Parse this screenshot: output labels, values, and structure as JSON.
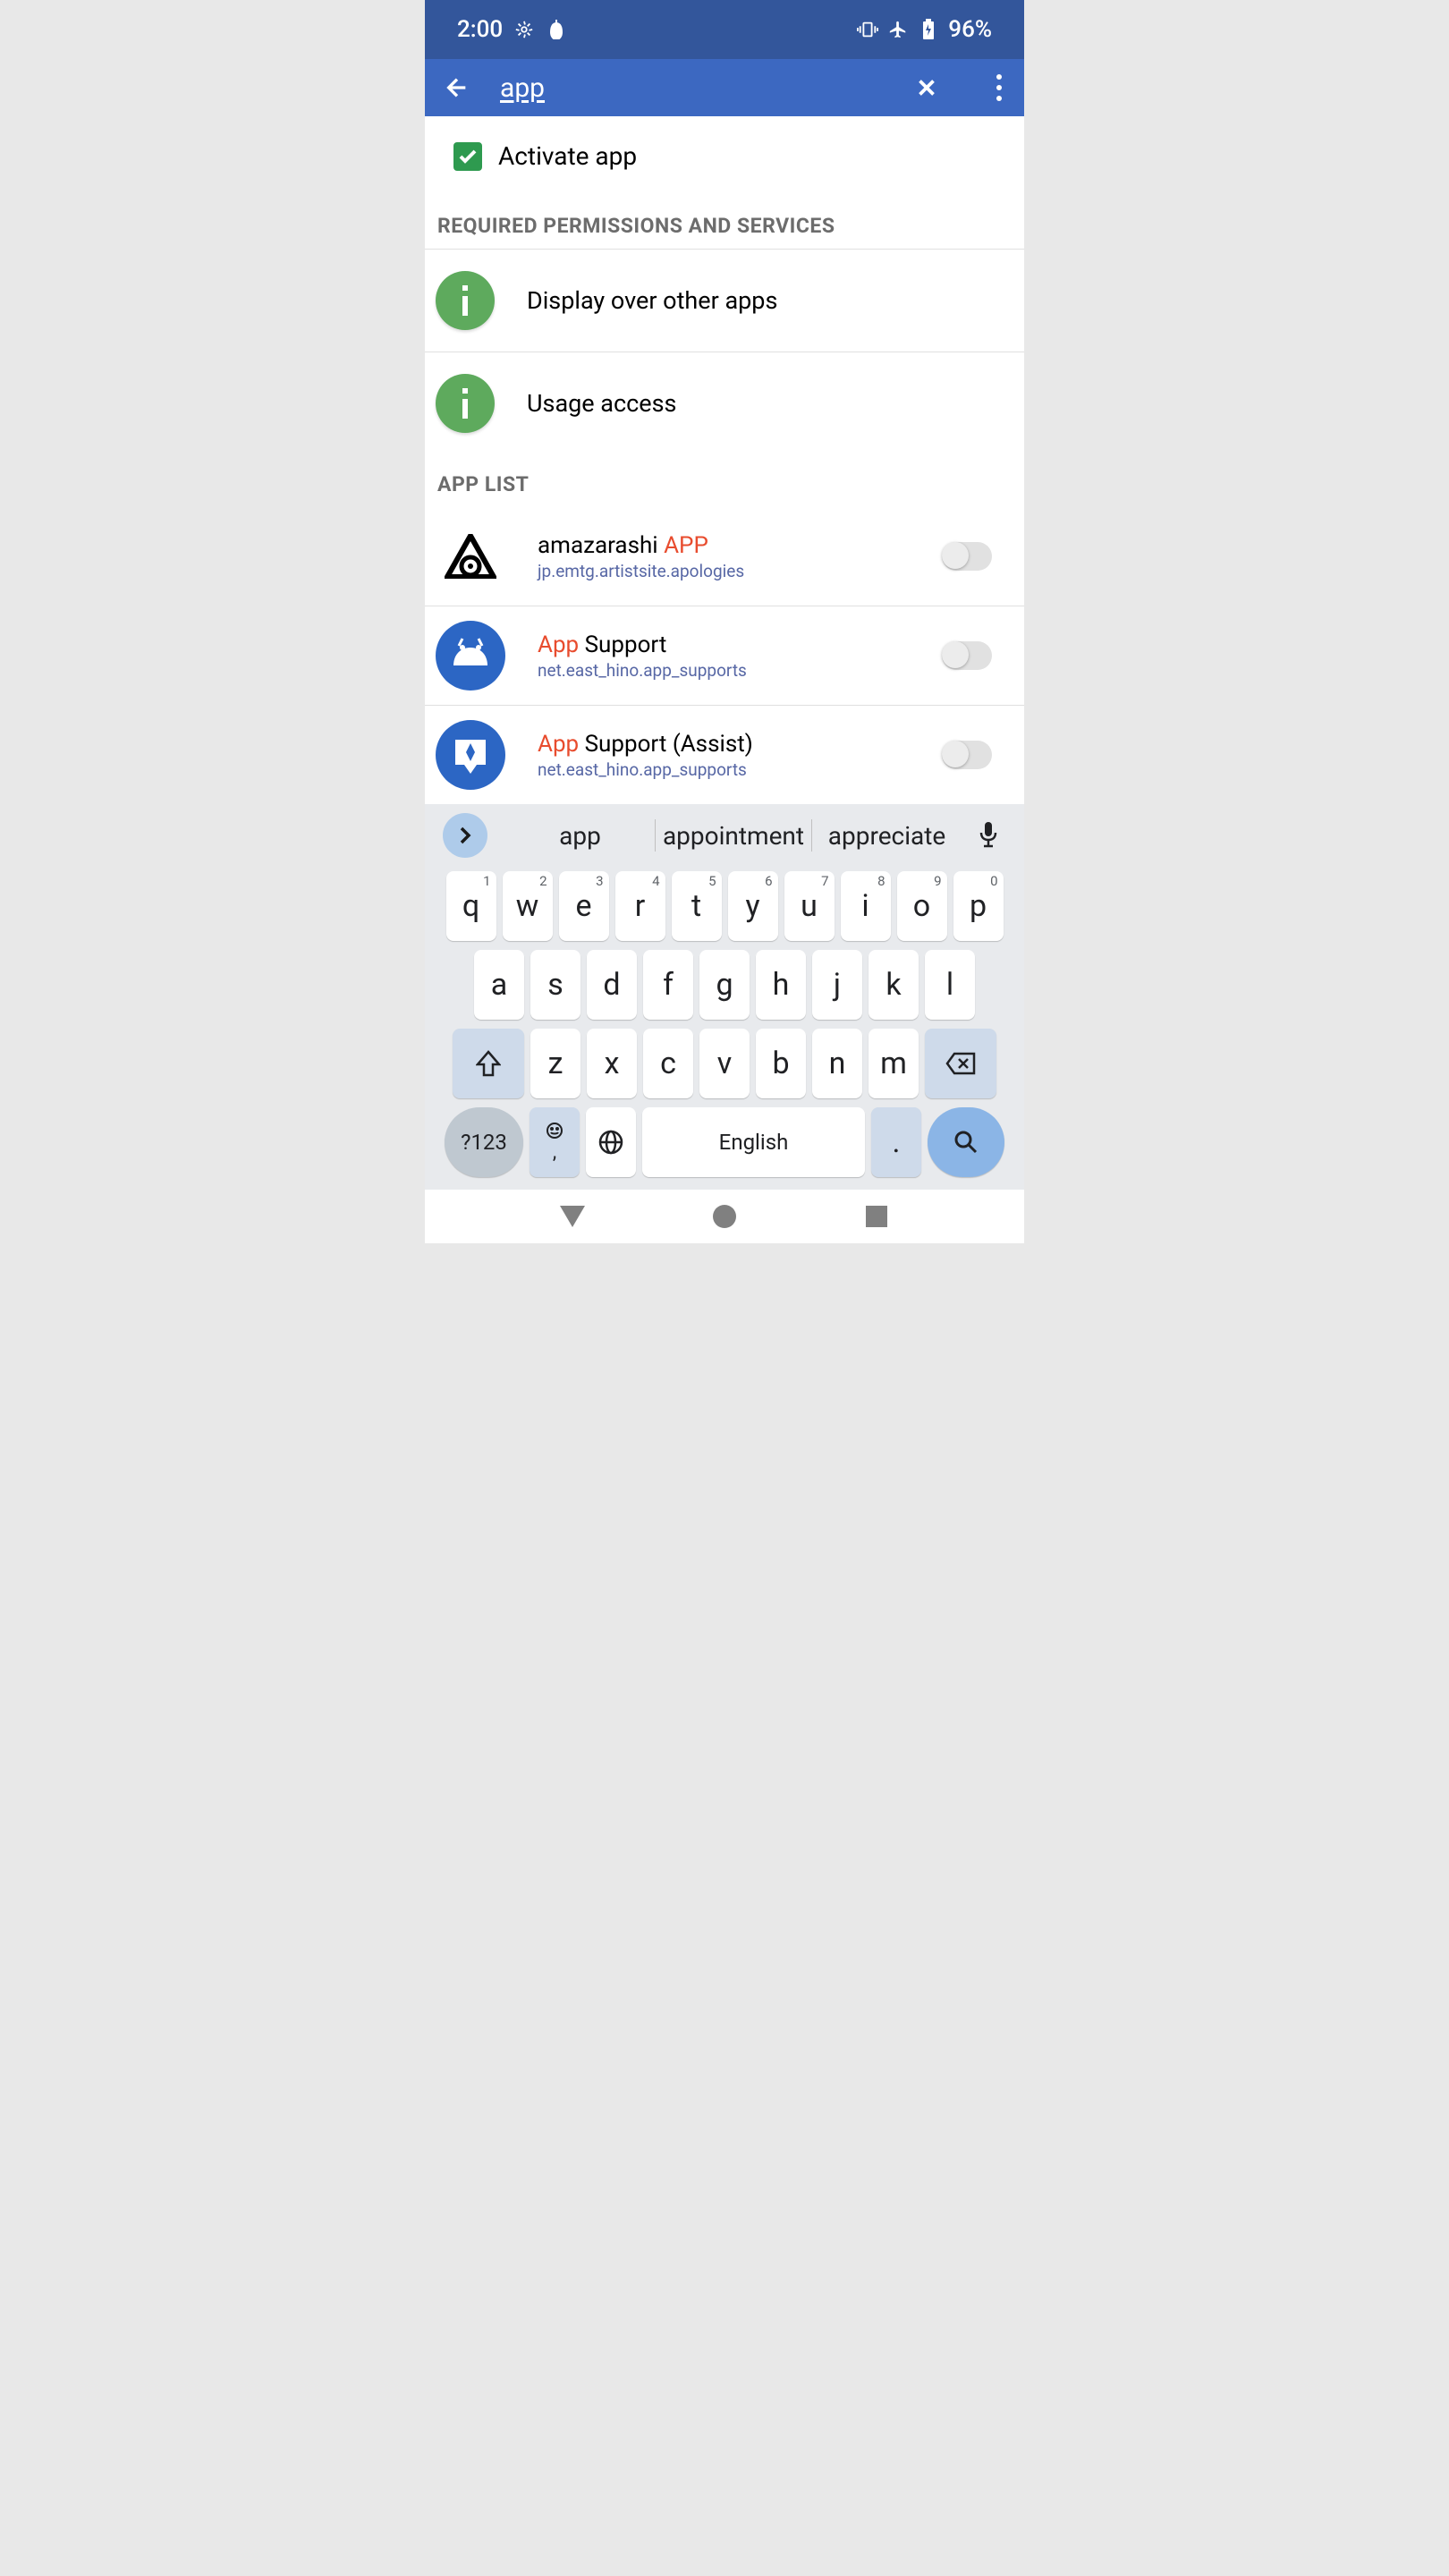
{
  "status": {
    "time": "2:00",
    "battery": "96%"
  },
  "search": {
    "query": "app"
  },
  "activate": {
    "label": "Activate app",
    "checked": true
  },
  "sections": {
    "permissions_header": "REQUIRED PERMISSIONS AND SERVICES",
    "applist_header": "APP LIST"
  },
  "permissions": [
    {
      "label": "Display over other apps"
    },
    {
      "label": "Usage access"
    }
  ],
  "apps": [
    {
      "name_pre": "amazarashi ",
      "name_hl": "APP",
      "name_post": "",
      "pkg": "jp.emtg.artistsite.apologies",
      "on": false
    },
    {
      "name_pre": "",
      "name_hl": "App",
      "name_post": " Support",
      "pkg": "net.east_hino.app_supports",
      "on": false
    },
    {
      "name_pre": "",
      "name_hl": "App",
      "name_post": " Support (Assist)",
      "pkg": "net.east_hino.app_supports",
      "on": false
    }
  ],
  "keyboard": {
    "suggestions": [
      "app",
      "appointment",
      "appreciate"
    ],
    "row1": [
      "q",
      "w",
      "e",
      "r",
      "t",
      "y",
      "u",
      "i",
      "o",
      "p"
    ],
    "row1nums": [
      "1",
      "2",
      "3",
      "4",
      "5",
      "6",
      "7",
      "8",
      "9",
      "0"
    ],
    "row2": [
      "a",
      "s",
      "d",
      "f",
      "g",
      "h",
      "j",
      "k",
      "l"
    ],
    "row3": [
      "z",
      "x",
      "c",
      "v",
      "b",
      "n",
      "m"
    ],
    "sym": "?123",
    "comma": ",",
    "space": "English",
    "period": "."
  }
}
